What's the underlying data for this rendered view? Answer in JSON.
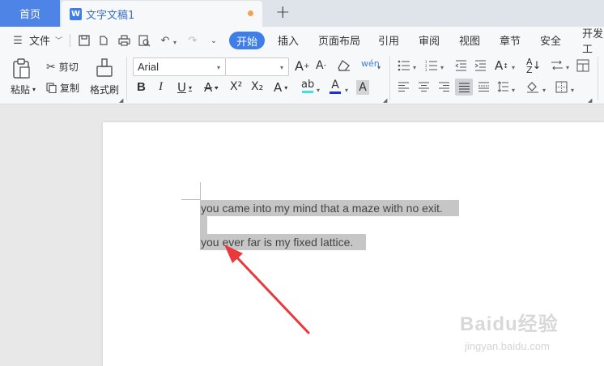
{
  "tabs": {
    "home_label": "首页",
    "doc_label": "文字文稿1",
    "doc_logo": "W",
    "new_tab_symbol": "+"
  },
  "menubar": {
    "file_label": "文件",
    "items": [
      "开始",
      "插入",
      "页面布局",
      "引用",
      "审阅",
      "视图",
      "章节",
      "安全",
      "开发工"
    ]
  },
  "ribbon": {
    "paste_label": "粘贴",
    "cut_label": "剪切",
    "copy_label": "复制",
    "format_painter_label": "格式刷",
    "font_name": "Arial",
    "font_size": "",
    "grow_font": "A",
    "shrink_font": "A",
    "pinyin_label": "wén",
    "bold": "B",
    "italic": "I",
    "underline": "U",
    "strikethrough": "A",
    "superscript": "X²",
    "subscript": "X₂",
    "text_effect": "A",
    "highlight": "ab",
    "font_color": "A",
    "char_shading": "A"
  },
  "document": {
    "line1": "you came into my mind that a maze with no exit.",
    "line2": "you ever far is my fixed lattice."
  },
  "watermark": {
    "brand": "Baidu经验",
    "url": "jingyan.baidu.com"
  },
  "colors": {
    "accent": "#3f7ee8",
    "home_tab": "#4d84e6",
    "selection": "#c6c6c6",
    "arrow": "#e8393b"
  }
}
